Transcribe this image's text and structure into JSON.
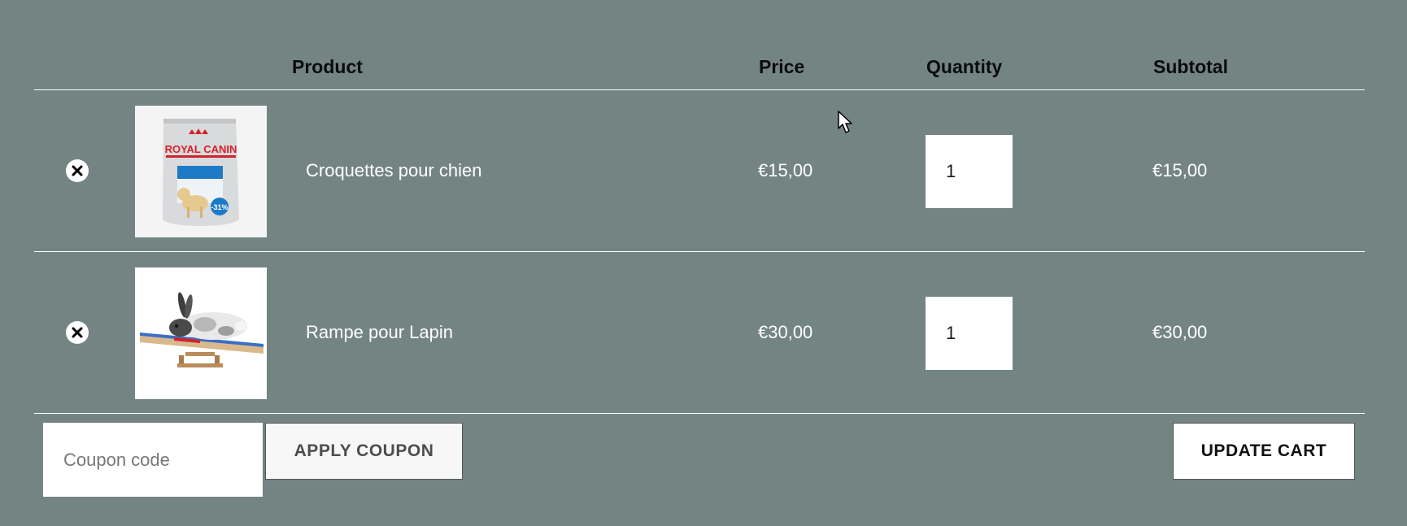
{
  "header": {
    "product": "Product",
    "price": "Price",
    "quantity": "Quantity",
    "subtotal": "Subtotal"
  },
  "items": [
    {
      "name": "Croquettes pour chien",
      "price": "€15,00",
      "quantity": "1",
      "subtotal": "€15,00",
      "image_icon": "dog-food-bag-image",
      "brand_text": "ROYAL CANIN",
      "badge_text": "-31%"
    },
    {
      "name": "Rampe pour Lapin",
      "price": "€30,00",
      "quantity": "1",
      "subtotal": "€30,00",
      "image_icon": "rabbit-ramp-image"
    }
  ],
  "coupon": {
    "placeholder": "Coupon code",
    "value": "",
    "apply_label": "APPLY COUPON"
  },
  "update_label": "UPDATE CART",
  "colors": {
    "background": "#738483",
    "border": "#ffffff",
    "header_text": "#0b0b0b",
    "cell_text": "#ffffff",
    "brand_red": "#d2232a"
  }
}
